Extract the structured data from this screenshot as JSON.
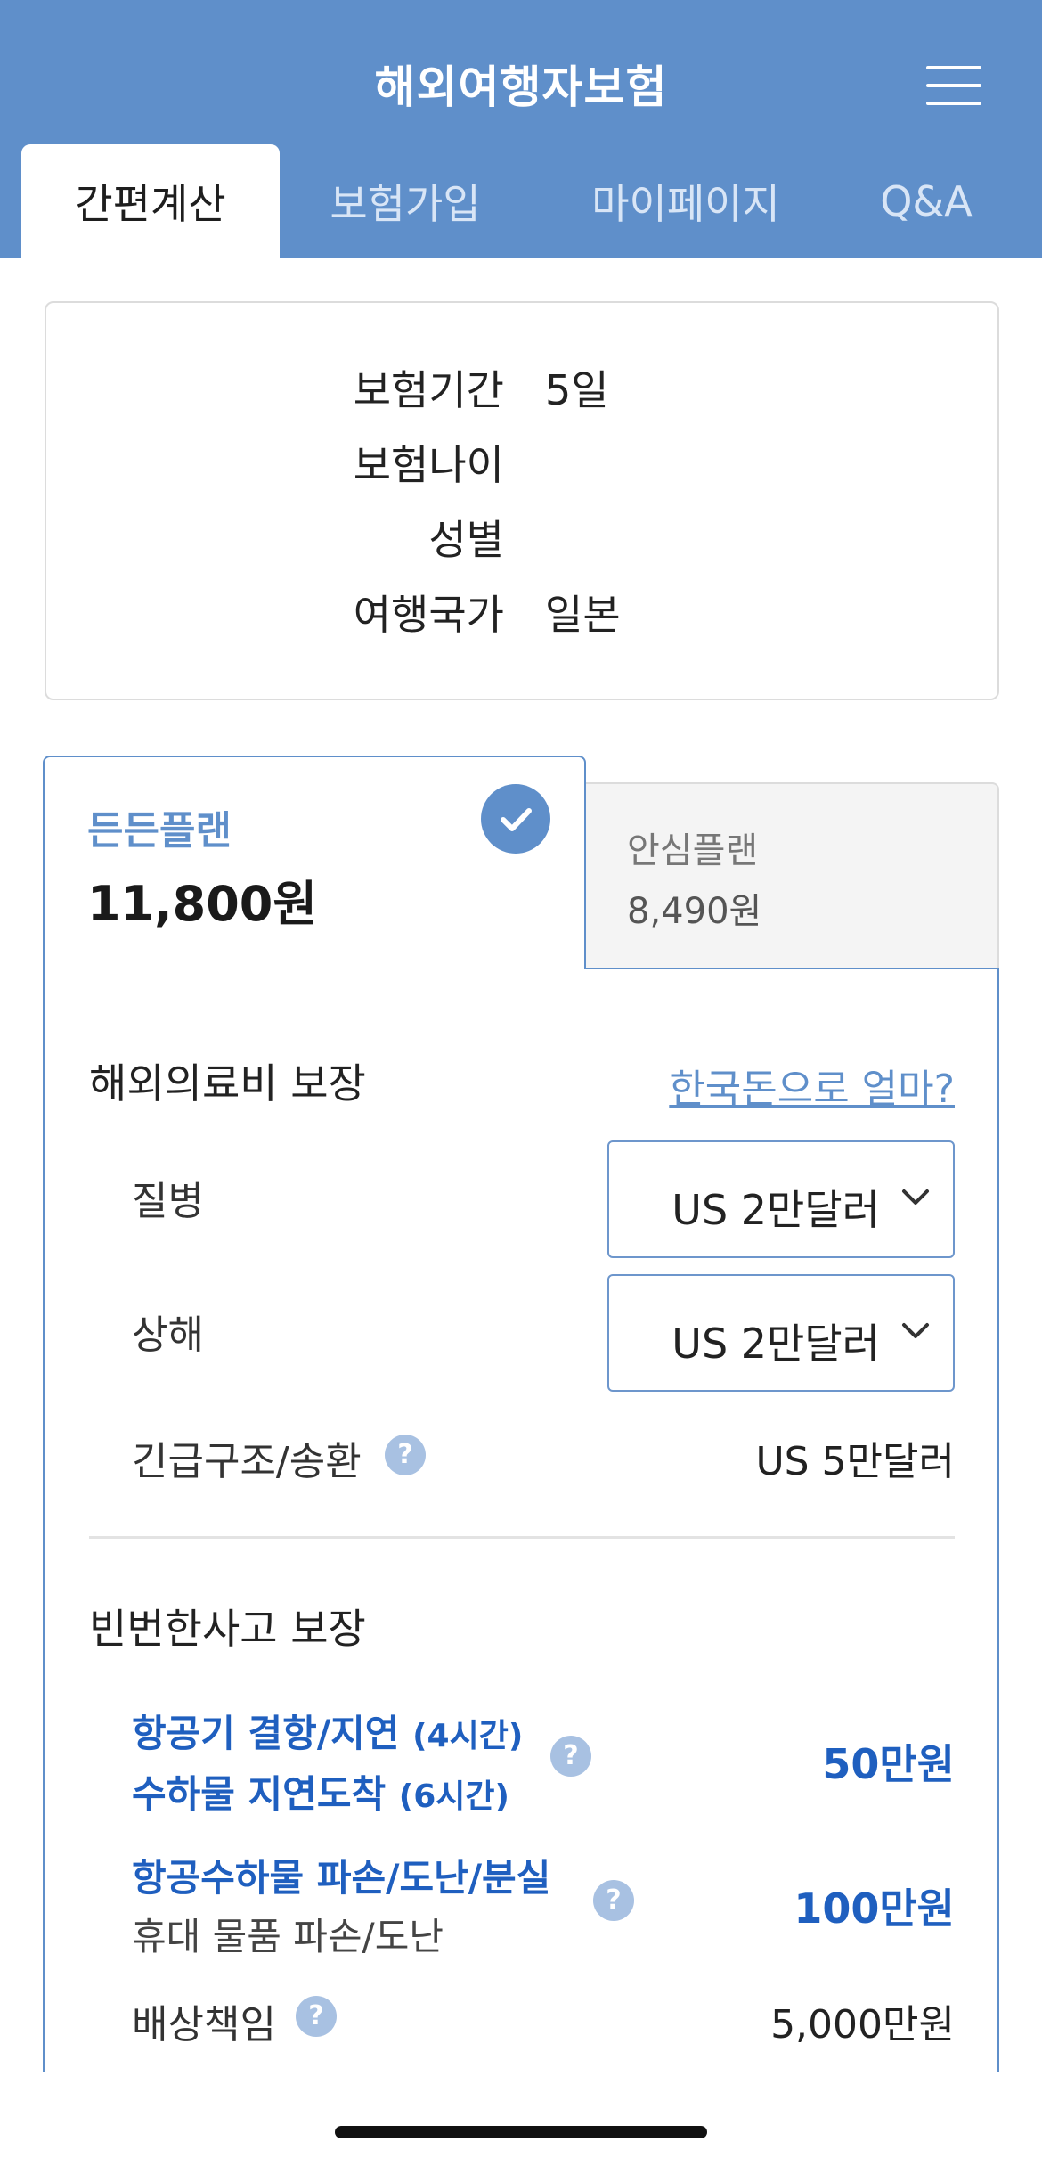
{
  "header": {
    "title": "해외여행자보험",
    "tabs": [
      {
        "label": "간편계산",
        "active": true
      },
      {
        "label": "보험가입",
        "active": false
      },
      {
        "label": "마이페이지",
        "active": false
      },
      {
        "label": "Q&A",
        "active": false
      }
    ],
    "menu_icon": "hamburger-menu-icon"
  },
  "summary": {
    "rows": [
      {
        "label": "보험기간",
        "value": "5일"
      },
      {
        "label": "보험나이",
        "value": ""
      },
      {
        "label": "성별",
        "value": ""
      },
      {
        "label": "여행국가",
        "value": "일본"
      }
    ]
  },
  "plans": [
    {
      "name": "든든플랜",
      "price": "11,800원",
      "selected": true
    },
    {
      "name": "안심플랜",
      "price": "8,490원",
      "selected": false
    }
  ],
  "medical": {
    "title": "해외의료비 보장",
    "krw_link": "한국돈으로 얼마?",
    "illness": {
      "label": "질병",
      "value": "US 2만달러"
    },
    "injury": {
      "label": "상해",
      "value": "US 2만달러"
    },
    "rescue": {
      "label": "긴급구조/송환",
      "value": "US 5만달러"
    }
  },
  "common": {
    "title": "빈번한사고 보장",
    "flight_delay": {
      "line1": "항공기 결항/지연",
      "line1_note": "(4시간)",
      "line2": "수하물 지연도착",
      "line2_note": "(6시간)",
      "value": "50만원"
    },
    "baggage": {
      "line1": "항공수하물 파손/도난/분실",
      "line2": "휴대 물품 파손/도난",
      "value": "100만원"
    },
    "liability": {
      "label": "배상책임",
      "value": "5,000만원"
    }
  },
  "help_glyph": "?",
  "colors": {
    "primary": "#5f8fca",
    "accent_blue": "#1f5fbf",
    "help_icon": "#a8c1e2"
  }
}
